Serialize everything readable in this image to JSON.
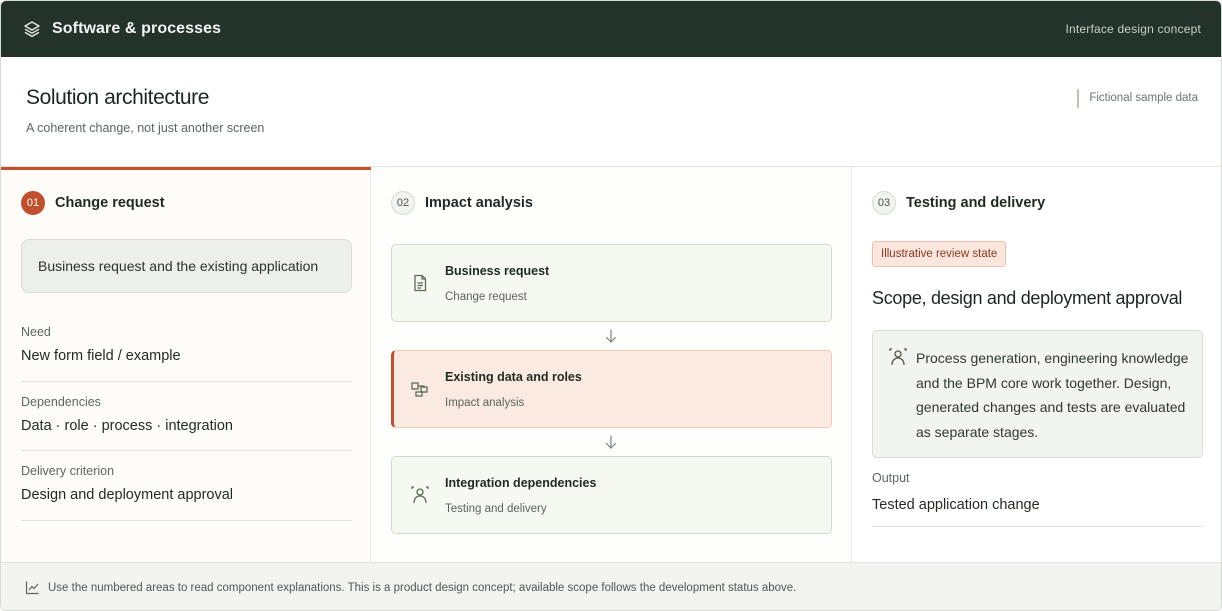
{
  "topbar": {
    "title": "Software & processes",
    "concept_label": "Interface design concept",
    "logo_icon": "layers-icon"
  },
  "header": {
    "title": "Solution architecture",
    "subtitle": "A coherent change, not just another screen",
    "sample_label": "Fictional sample data"
  },
  "steps": [
    {
      "number": "01",
      "label": "Change request",
      "active": true
    },
    {
      "number": "02",
      "label": "Impact analysis",
      "active": false
    },
    {
      "number": "03",
      "label": "Testing and delivery",
      "active": false
    }
  ],
  "change_request": {
    "summary": "Business request and the existing application",
    "fields": [
      {
        "label": "Need",
        "value": "New form field / example"
      },
      {
        "label": "Dependencies",
        "value": "Data · role · process · integration"
      },
      {
        "label": "Delivery criterion",
        "value": "Design and deployment approval"
      }
    ]
  },
  "impact": {
    "cards": [
      {
        "title": "Business request",
        "subtitle": "Change request",
        "icon": "document-icon",
        "highlighted": false
      },
      {
        "title": "Existing data and roles",
        "subtitle": "Impact analysis",
        "icon": "hierarchy-icon",
        "highlighted": true
      },
      {
        "title": "Integration dependencies",
        "subtitle": "Testing and delivery",
        "icon": "user-scan-icon",
        "highlighted": false
      }
    ],
    "arrow_icon": "arrow-down-icon"
  },
  "delivery": {
    "badge": "Illustrative review state",
    "scope_title": "Scope, design and deployment approval",
    "note": "Process generation, engineering knowledge and the BPM core work together. Design, generated changes and tests are evaluated as separate stages.",
    "note_icon": "user-scan-icon",
    "output_label": "Output",
    "output_value": "Tested application change"
  },
  "footer": {
    "icon": "trend-chart-icon",
    "text": "Use the numbered areas to read component explanations. This is a product design concept; available scope follows the development status above."
  },
  "colors": {
    "topbar_bg": "#23322a",
    "accent": "#c1502e",
    "card_bg": "#f6f9f2",
    "highlight_bg": "#fbeae1"
  }
}
